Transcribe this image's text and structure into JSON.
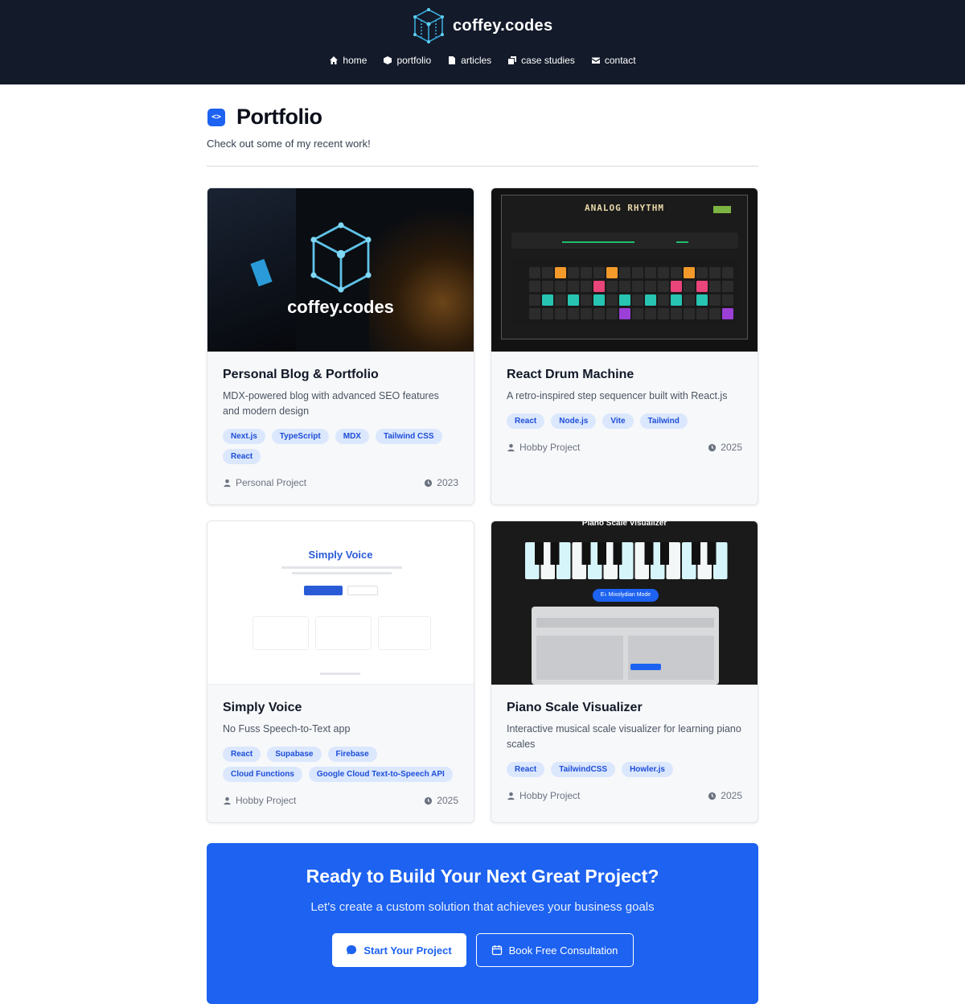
{
  "brand": {
    "name": "coffey.codes"
  },
  "nav": [
    {
      "label": "home",
      "icon": "home-icon"
    },
    {
      "label": "portfolio",
      "icon": "cube-icon"
    },
    {
      "label": "articles",
      "icon": "document-icon"
    },
    {
      "label": "case studies",
      "icon": "copy-icon"
    },
    {
      "label": "contact",
      "icon": "envelope-icon"
    }
  ],
  "page": {
    "title": "Portfolio",
    "subtitle": "Check out some of my recent work!"
  },
  "projects": [
    {
      "title": "Personal Blog & Portfolio",
      "description": "MDX-powered blog with advanced SEO features and modern design",
      "tags": [
        "Next.js",
        "TypeScript",
        "MDX",
        "Tailwind CSS",
        "React"
      ],
      "type": "Personal Project",
      "year": "2023",
      "image_text": "coffey.codes"
    },
    {
      "title": "React Drum Machine",
      "description": "A retro-inspired step sequencer built with React.js",
      "tags": [
        "React",
        "Node.js",
        "Vite",
        "Tailwind"
      ],
      "type": "Hobby Project",
      "year": "2025",
      "image_text": "ANALOG RHYTHM"
    },
    {
      "title": "Simply Voice",
      "description": "No Fuss Speech-to-Text app",
      "tags": [
        "React",
        "Supabase",
        "Firebase",
        "Cloud Functions",
        "Google Cloud Text-to-Speech API"
      ],
      "type": "Hobby Project",
      "year": "2025",
      "image_text": "Simply Voice"
    },
    {
      "title": "Piano Scale Visualizer",
      "description": "Interactive musical scale visualizer for learning piano scales",
      "tags": [
        "React",
        "TailwindCSS",
        "Howler.js"
      ],
      "type": "Hobby Project",
      "year": "2025",
      "image_text": "Piano Scale Visualizer",
      "image_mode": "E♭ Mixolydian Mode"
    }
  ],
  "cta": {
    "title": "Ready to Build Your Next Great Project?",
    "subtitle": "Let's create a custom solution that achieves your business goals",
    "primary_label": "Start Your Project",
    "secondary_label": "Book Free Consultation"
  },
  "colors": {
    "header_bg": "#131a2a",
    "accent": "#1d62f0",
    "tag_bg": "#dbe7fd",
    "tag_text": "#1d4ed8"
  }
}
